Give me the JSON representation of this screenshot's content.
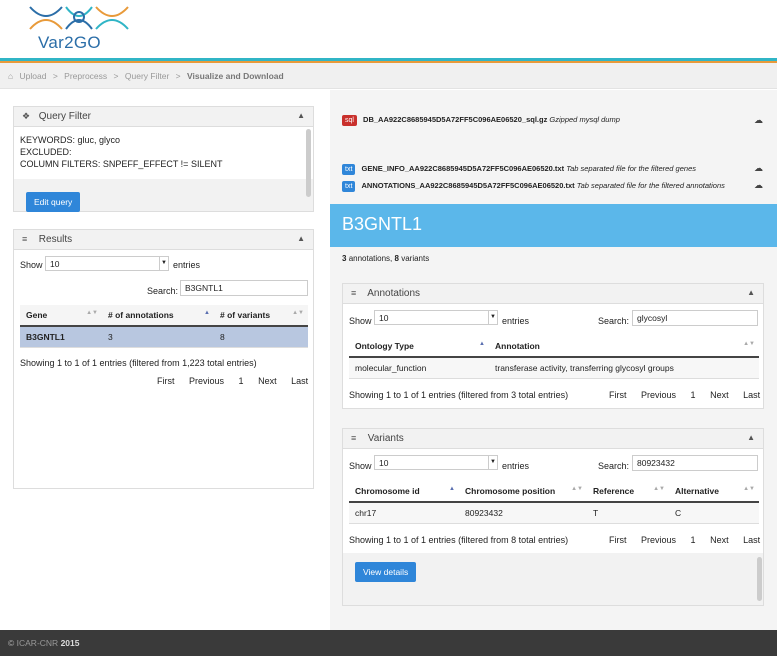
{
  "app": {
    "logo_text": "Var2GO"
  },
  "breadcrumb": {
    "items": [
      "Upload",
      "Preprocess",
      "Query Filter"
    ],
    "current": "Visualize and Download",
    "sep": ">"
  },
  "query_filter": {
    "title": "Query Filter",
    "keywords": "KEYWORDS: gluc, glyco",
    "excluded": "EXCLUDED:",
    "column_filters": "COLUMN FILTERS: SNPEFF_EFFECT != SILENT",
    "edit_label": "Edit query"
  },
  "results": {
    "title": "Results",
    "show_label": "Show",
    "entries_value": "10",
    "entries_label": "entries",
    "search_label": "Search:",
    "search_value": "B3GNTL1",
    "columns": [
      "Gene",
      "# of annotations",
      "# of variants"
    ],
    "rows": [
      [
        "B3GNTL1",
        "3",
        "8"
      ]
    ],
    "info": "Showing 1 to 1 of 1 entries (filtered from 1,223 total entries)",
    "pager": [
      "First",
      "Previous",
      "1",
      "Next",
      "Last"
    ]
  },
  "files": [
    {
      "tag": "sql",
      "tag_color": "#c9302c",
      "name": "DB_AA922C8685945D5A72FF5C096AE06520_sql.gz",
      "desc": "Gzipped mysql dump"
    },
    {
      "tag": "txt",
      "tag_color": "#2f86d9",
      "name": "GENE_INFO_AA922C8685945D5A72FF5C096AE06520.txt",
      "desc": "Tab separated file for the filtered genes"
    },
    {
      "tag": "txt",
      "tag_color": "#2f86d9",
      "name": "ANNOTATIONS_AA922C8685945D5A72FF5C096AE06520.txt",
      "desc": "Tab separated file for the filtered annotations"
    }
  ],
  "gene": {
    "name": "B3GNTL1",
    "summary_annotations": "3",
    "summary_annotations_label": "annotations,",
    "summary_variants": "8",
    "summary_variants_label": "variants"
  },
  "annotations": {
    "title": "Annotations",
    "show_label": "Show",
    "entries_value": "10",
    "entries_label": "entries",
    "search_label": "Search:",
    "search_value": "glycosyl",
    "columns": [
      "Ontology Type",
      "Annotation"
    ],
    "rows": [
      [
        "molecular_function",
        "transferase activity, transferring glycosyl groups"
      ]
    ],
    "info": "Showing 1 to 1 of 1 entries (filtered from 3 total entries)",
    "pager": [
      "First",
      "Previous",
      "1",
      "Next",
      "Last"
    ]
  },
  "variants": {
    "title": "Variants",
    "show_label": "Show",
    "entries_value": "10",
    "entries_label": "entries",
    "search_label": "Search:",
    "search_value": "80923432",
    "columns": [
      "Chromosome id",
      "Chromosome position",
      "Reference",
      "Alternative"
    ],
    "rows": [
      [
        "chr17",
        "80923432",
        "T",
        "C"
      ]
    ],
    "info": "Showing 1 to 1 of 1 entries (filtered from 8 total entries)",
    "pager": [
      "First",
      "Previous",
      "1",
      "Next",
      "Last"
    ],
    "details_label": "View details"
  },
  "footer": {
    "copyright": "©",
    "org": "ICAR-CNR",
    "year": "2015"
  },
  "colors": {
    "accent": "#2f86d9",
    "gene_band": "#5bb7ea",
    "selected_row": "#b8c7e0"
  }
}
